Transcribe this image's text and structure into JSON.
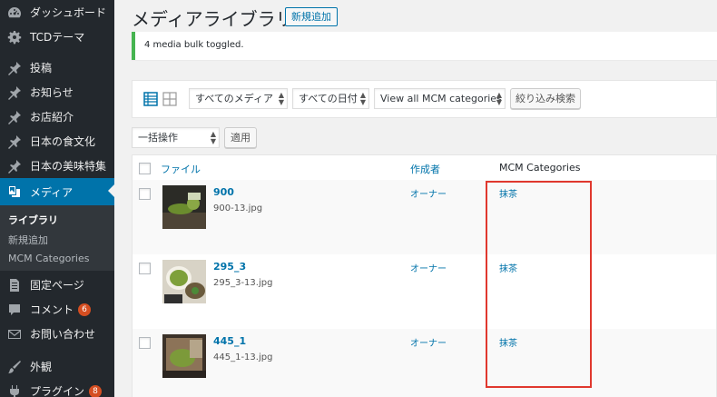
{
  "sidebar": {
    "items": [
      {
        "label": "ダッシュボード",
        "icon": "dashboard-icon"
      },
      {
        "label": "TCDテーマ",
        "icon": "gear-icon"
      },
      {
        "label": "投稿",
        "icon": "pin-icon"
      },
      {
        "label": "お知らせ",
        "icon": "pin-icon"
      },
      {
        "label": "お店紹介",
        "icon": "pin-icon"
      },
      {
        "label": "日本の食文化",
        "icon": "pin-icon"
      },
      {
        "label": "日本の美味特集",
        "icon": "pin-icon"
      },
      {
        "label": "メディア",
        "icon": "media-icon",
        "active": true
      },
      {
        "label": "固定ページ",
        "icon": "page-icon"
      },
      {
        "label": "コメント",
        "icon": "comment-icon",
        "badge": "6"
      },
      {
        "label": "お問い合わせ",
        "icon": "mail-icon"
      },
      {
        "label": "外観",
        "icon": "brush-icon"
      },
      {
        "label": "プラグイン",
        "icon": "plugin-icon",
        "badge": "8"
      }
    ],
    "submenu": [
      "ライブラリ",
      "新規追加",
      "MCM Categories"
    ]
  },
  "header": {
    "title": "メディアライブラリ",
    "add_new": "新規追加"
  },
  "notice": {
    "message": "4 media bulk toggled."
  },
  "filters": {
    "media_type": "すべてのメディア",
    "date": "すべての日付",
    "category": "View all MCM categories",
    "filter_button": "絞り込み検索"
  },
  "bulk": {
    "action": "一括操作",
    "apply": "適用"
  },
  "table": {
    "columns": [
      "ファイル",
      "作成者",
      "MCM Categories"
    ],
    "rows": [
      {
        "title": "900",
        "filename": "900-13.jpg",
        "author": "オーナー",
        "category": "抹茶"
      },
      {
        "title": "295_3",
        "filename": "295_3-13.jpg",
        "author": "オーナー",
        "category": "抹茶"
      },
      {
        "title": "445_1",
        "filename": "445_1-13.jpg",
        "author": "オーナー",
        "category": "抹茶"
      }
    ]
  },
  "colors": {
    "sidebar_bg": "#23282d",
    "active": "#0073aa",
    "link": "#0073aa",
    "notice_success": "#46b450",
    "highlight": "#e0382e",
    "badge": "#d54e21"
  }
}
